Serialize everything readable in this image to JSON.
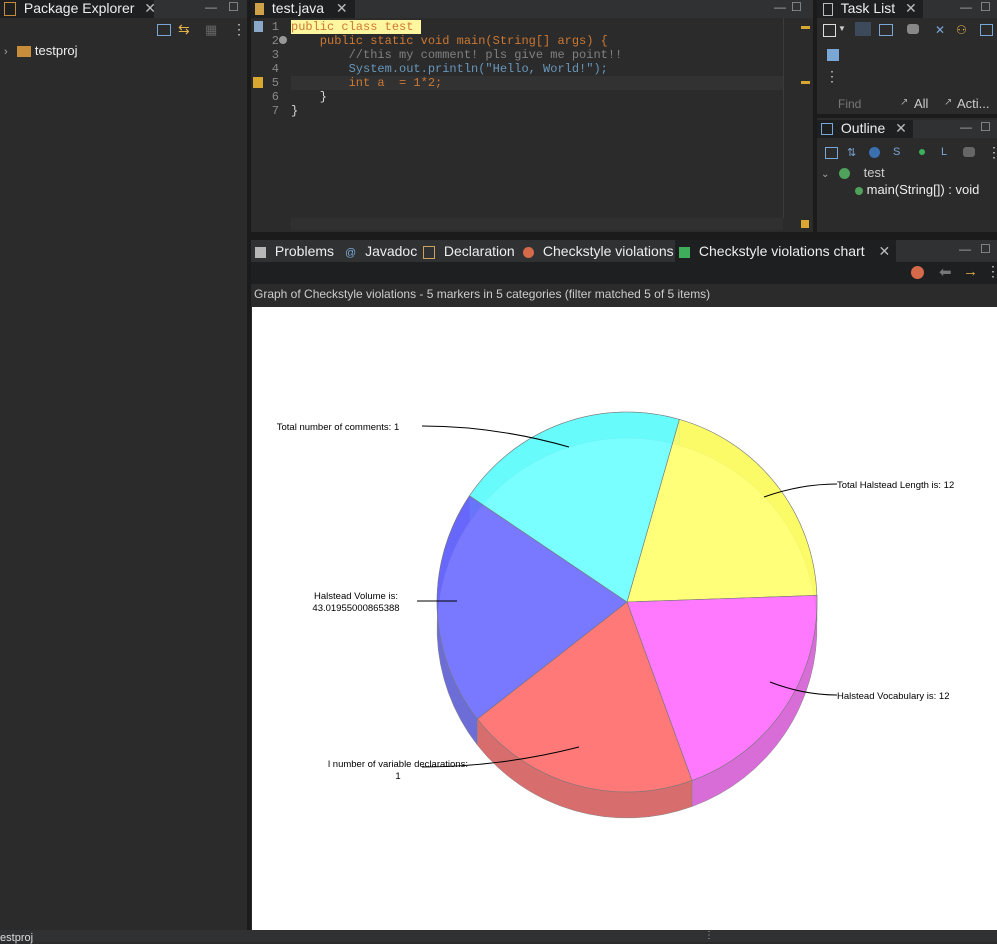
{
  "package_explorer": {
    "tab_label": "Package Explorer",
    "tree": [
      {
        "label": "testproj"
      }
    ]
  },
  "editor": {
    "tab_label": "test.java",
    "line_numbers": [
      "1",
      "2",
      "3",
      "4",
      "5",
      "6",
      "7"
    ],
    "lines": [
      "public class test ",
      "    public static void main(String[] args) {",
      "        //this my comment! pls give me point!!",
      "        System.out.println(\"Hello, World!\");",
      "        int a  = 1*2;",
      "    }",
      "}"
    ]
  },
  "task_list": {
    "tab_label": "Task List",
    "find_placeholder": "Find",
    "all_label": "All",
    "acti_label": "Acti..."
  },
  "outline": {
    "tab_label": "Outline",
    "class_label": "test",
    "method_label": "main(String[]) : void"
  },
  "bottom_tabs": [
    {
      "label": "Problems"
    },
    {
      "label": "Javadoc"
    },
    {
      "label": "Declaration"
    },
    {
      "label": "Checkstyle violations"
    },
    {
      "label": "Checkstyle violations chart"
    }
  ],
  "chart_panel": {
    "summary": "Graph of Checkstyle violations - 5 markers in 5 categories (filter matched 5 of 5 items)"
  },
  "chart_data": {
    "type": "pie",
    "slices": [
      {
        "label": "Total Halstead Length is: 12",
        "value": 12,
        "color": "#ffff66"
      },
      {
        "label": "Halstead Vocabulary is: 12",
        "value": 12,
        "color": "#ff66ff"
      },
      {
        "label": "l number of variable declarations:\n1",
        "value": 1,
        "color": "#ff6666"
      },
      {
        "label": "Halstead Volume is:\n43.01955000865388",
        "value": 43.01955000865388,
        "color": "#6666ff"
      },
      {
        "label": "Total number of comments: 1",
        "value": 1,
        "color": "#66ffff"
      }
    ]
  },
  "status_bar": {
    "text": "testproj"
  },
  "colors": {
    "background": "#2b2b2b",
    "editor_bg": "#2b2b2b",
    "chart_bg": "#ffffff",
    "active_tab": "#1e1f21"
  }
}
